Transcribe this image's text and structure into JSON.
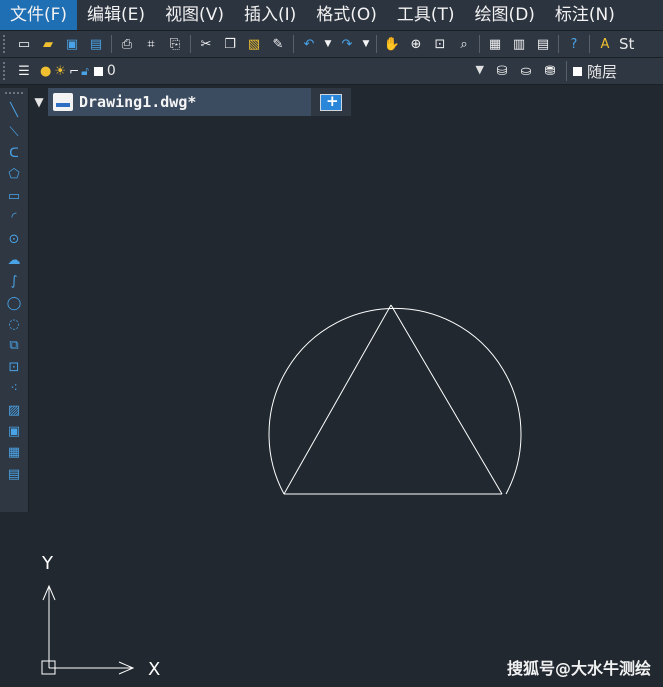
{
  "menubar": {
    "items": [
      "文件(F)",
      "编辑(E)",
      "视图(V)",
      "插入(I)",
      "格式(O)",
      "工具(T)",
      "绘图(D)",
      "标注(N)"
    ],
    "active_index": 0
  },
  "toolbar": {
    "style_label": "St"
  },
  "layer": {
    "name": "0",
    "color_label": "随层"
  },
  "tabs": {
    "active_title": "Drawing1.dwg*",
    "close_glyph": "✕"
  },
  "ucs": {
    "x_label": "X",
    "y_label": "Y"
  },
  "watermark": "搜狐号@大水牛测绘",
  "colors": {
    "canvas": "#212830",
    "menu_active": "#1f6fb5",
    "icon_blue": "#4aa3e6",
    "icon_yellow": "#f0c030"
  },
  "icons": {
    "draw_tools": [
      "line-icon",
      "construction-line-icon",
      "polyline-icon",
      "polygon-icon",
      "rectangle-icon",
      "arc-icon",
      "circle-icon",
      "revision-cloud-icon",
      "spline-icon",
      "ellipse-icon",
      "ellipse-arc-icon",
      "insert-block-icon",
      "make-block-icon",
      "point-icon",
      "hatch-icon",
      "region-icon",
      "table-icon",
      "mtext-icon"
    ]
  }
}
